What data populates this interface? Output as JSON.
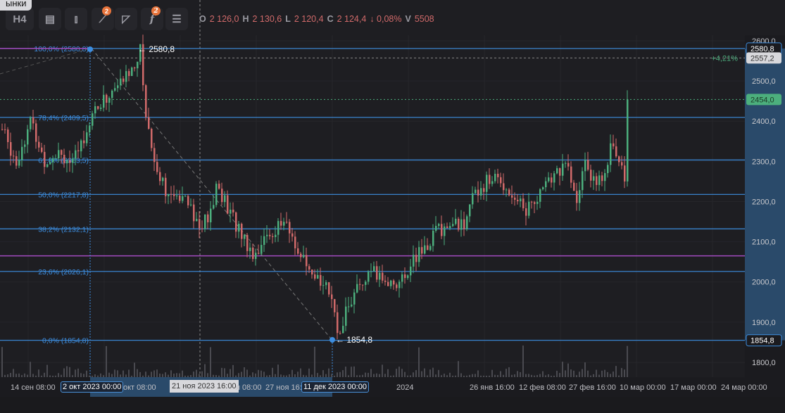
{
  "tooltip": "ынки",
  "toolbar": {
    "interval": "H4",
    "badge_indicators": "2",
    "badge_fx": "2"
  },
  "ohlc": {
    "o_label": "O",
    "o": "2 126,0",
    "h_label": "H",
    "h": "2 130,6",
    "l_label": "L",
    "l": "2 120,4",
    "c_label": "C",
    "c": "2 124,4",
    "change": "↓ 0,08%",
    "v_label": "V",
    "v": "5508"
  },
  "chart_data": {
    "type": "candlestick",
    "title": "H4",
    "ylim": [
      1780,
      2620
    ],
    "yticks": [
      "2600,0",
      "2500,0",
      "2400,0",
      "2300,0",
      "2200,0",
      "2100,0",
      "2000,0",
      "1900,0",
      "1800,0"
    ],
    "ytick_values": [
      2600,
      2500,
      2400,
      2300,
      2200,
      2100,
      2000,
      1900,
      1800
    ],
    "xticks": [
      "14 сен 08:00",
      "2 окт 2023 00:00",
      "окт 08:00",
      "21 ноя 2023 16:00",
      "я 08:00",
      "27 ноя 16:",
      "11 дек 2023 00:00",
      "2024",
      "26 янв 16:00",
      "12 фев 08:00",
      "27 фев 16:00",
      "10 мар 00:00",
      "17 мар 00:00",
      "24 мар 00:00"
    ],
    "price_path_bar_index_close": [
      [
        0,
        2380
      ],
      [
        5,
        2300
      ],
      [
        10,
        2400
      ],
      [
        15,
        2300
      ],
      [
        20,
        2330
      ],
      [
        25,
        2290
      ],
      [
        32,
        2420
      ],
      [
        40,
        2480
      ],
      [
        45,
        2520
      ],
      [
        49,
        2575
      ],
      [
        51,
        2420
      ],
      [
        54,
        2300
      ],
      [
        60,
        2200
      ],
      [
        65,
        2230
      ],
      [
        70,
        2130
      ],
      [
        75,
        2180
      ],
      [
        76,
        2250
      ],
      [
        80,
        2180
      ],
      [
        86,
        2110
      ],
      [
        89,
        2070
      ],
      [
        95,
        2120
      ],
      [
        100,
        2150
      ],
      [
        105,
        2080
      ],
      [
        110,
        2000
      ],
      [
        115,
        2010
      ],
      [
        119,
        1870
      ],
      [
        122,
        1930
      ],
      [
        127,
        1990
      ],
      [
        132,
        2020
      ],
      [
        137,
        2000
      ],
      [
        142,
        2000
      ],
      [
        145,
        2050
      ],
      [
        150,
        2080
      ],
      [
        154,
        2130
      ],
      [
        160,
        2140
      ],
      [
        165,
        2150
      ],
      [
        168,
        2230
      ],
      [
        175,
        2260
      ],
      [
        180,
        2230
      ],
      [
        186,
        2180
      ],
      [
        192,
        2230
      ],
      [
        200,
        2300
      ],
      [
        204,
        2190
      ],
      [
        207,
        2310
      ],
      [
        211,
        2230
      ],
      [
        216,
        2330
      ],
      [
        220,
        2300
      ],
      [
        221,
        2270
      ],
      [
        222,
        2454
      ]
    ],
    "fib_levels": [
      {
        "label": "100,0% (2580,8)",
        "value": 2580.8
      },
      {
        "label": "78,4% (2409,5)",
        "value": 2409.5
      },
      {
        "label": "61,8% (2303,5)",
        "value": 2303.5
      },
      {
        "label": "50,0% (2217,8)",
        "value": 2217.8
      },
      {
        "label": "38,2% (2132,1)",
        "value": 2132.1
      },
      {
        "label": "23,6% (2026,1)",
        "value": 2026.1
      },
      {
        "label": "0,0% (1854,8)",
        "value": 1854.8
      }
    ],
    "purple_level": 2065,
    "high_marker": "2580,8",
    "low_marker": "1854,8",
    "labels": {
      "high": "2580,8",
      "crosshair": "2557,2",
      "crosshair_pct": "+4,21%",
      "last": "2454,0",
      "low": "1854,8"
    },
    "values": {
      "crosshair": 2557.2,
      "last": 2454.0
    }
  },
  "colors": {
    "up": "#4caf7d",
    "down": "#d16a6a",
    "fib": "#3d8ee0",
    "purple": "#a24bbf",
    "bg": "#1e1e22"
  }
}
